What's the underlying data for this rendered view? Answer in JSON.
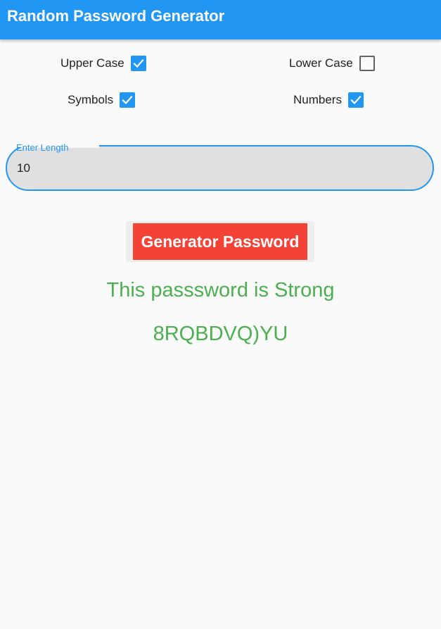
{
  "app": {
    "title": "Random Password Generator"
  },
  "options": {
    "upper_case": {
      "label": "Upper Case",
      "checked": true
    },
    "lower_case": {
      "label": "Lower Case",
      "checked": false
    },
    "symbols": {
      "label": "Symbols",
      "checked": true
    },
    "numbers": {
      "label": "Numbers",
      "checked": true
    }
  },
  "length_field": {
    "label": "Enter Length",
    "value": "10"
  },
  "generate_button": {
    "label": "Generator Password"
  },
  "result": {
    "strength_text": "This passsword is Strong",
    "password": "8RQBDVQ)YU"
  },
  "colors": {
    "primary": "#2196f3",
    "button": "#f44336",
    "success": "#4caf50",
    "background": "#fafafa"
  }
}
